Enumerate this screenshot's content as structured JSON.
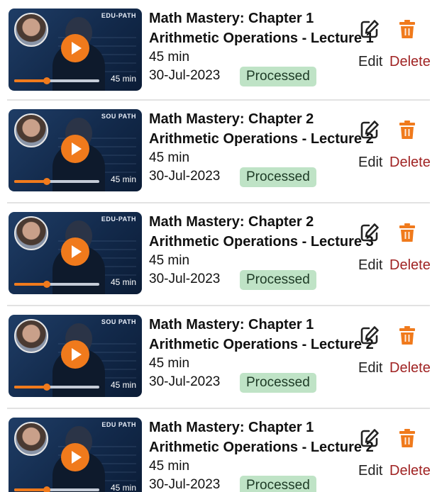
{
  "colors": {
    "accent_orange": "#f07a1c",
    "badge_bg": "#bfe3c6",
    "delete_red": "#a02323"
  },
  "icons": {
    "play": "play-icon",
    "edit": "edit-icon",
    "delete": "trash-icon"
  },
  "lectures": [
    {
      "chapter": "Math Mastery: Chapter 1",
      "lecture": "Arithmetic Operations - Lecture 1",
      "duration": "45 min",
      "date": "30-Jul-2023",
      "status": "Processed",
      "thumb_brand": "EDU-PATH",
      "thumb_duration": "45 min",
      "playback_progress": 0.38,
      "edit_label": "Edit",
      "delete_label": "Delete"
    },
    {
      "chapter": "Math Mastery: Chapter 2",
      "lecture": "Arithmetic Operations - Lecture 2",
      "duration": "45 min",
      "date": "30-Jul-2023",
      "status": "Processed",
      "thumb_brand": "SOU PATH",
      "thumb_duration": "45 min",
      "playback_progress": 0.38,
      "edit_label": "Edit",
      "delete_label": "Delete"
    },
    {
      "chapter": "Math Mastery: Chapter 2",
      "lecture": "Arithmetic Operations - Lecture 3",
      "duration": "45 min",
      "date": "30-Jul-2023",
      "status": "Processed",
      "thumb_brand": "EDU-PATH",
      "thumb_duration": "45 min",
      "playback_progress": 0.38,
      "edit_label": "Edit",
      "delete_label": "Delete"
    },
    {
      "chapter": "Math Mastery: Chapter 1",
      "lecture": "Arithmetic Operations - Lecture 2",
      "duration": "45 min",
      "date": "30-Jul-2023",
      "status": "Processed",
      "thumb_brand": "SOU PATH",
      "thumb_duration": "45 min",
      "playback_progress": 0.38,
      "edit_label": "Edit",
      "delete_label": "Delete"
    },
    {
      "chapter": "Math Mastery: Chapter 1",
      "lecture": "Arithmetic Operations - Lecture 2",
      "duration": "45 min",
      "date": "30-Jul-2023",
      "status": "Processed",
      "thumb_brand": "EDU PATH",
      "thumb_duration": "45 min",
      "playback_progress": 0.38,
      "edit_label": "Edit",
      "delete_label": "Delete"
    }
  ]
}
